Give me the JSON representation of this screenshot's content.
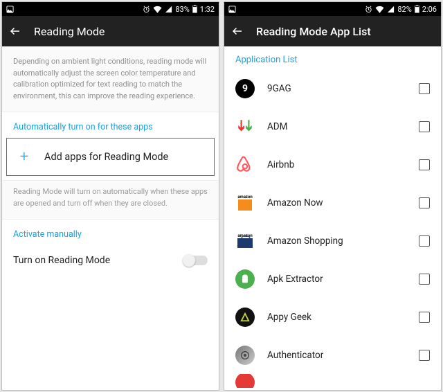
{
  "left": {
    "status": {
      "battery": "83%",
      "time": "1:32"
    },
    "title": "Reading Mode",
    "description": "Depending on ambient light conditions, reading mode will automatically adjust the screen color temperature and calibration optimized for text reading to match the environment, this can improve the reading experience.",
    "auto_section": "Automatically turn on for these apps",
    "add_label": "Add apps for Reading Mode",
    "sub_description": "Reading Mode will turn on automatically when these apps are opened and turn off when they are closed.",
    "activate_section": "Activate manually",
    "toggle_label": "Turn on Reading Mode"
  },
  "right": {
    "status": {
      "battery": "82%",
      "time": "2:06"
    },
    "title": "Reading Mode App List",
    "list_header": "Application List",
    "apps": {
      "0": {
        "label": "9GAG"
      },
      "1": {
        "label": "ADM"
      },
      "2": {
        "label": "Airbnb"
      },
      "3": {
        "label": "Amazon Now"
      },
      "4": {
        "label": "Amazon Shopping"
      },
      "5": {
        "label": "Apk Extractor"
      },
      "6": {
        "label": "Appy Geek"
      },
      "7": {
        "label": "Authenticator"
      }
    }
  }
}
